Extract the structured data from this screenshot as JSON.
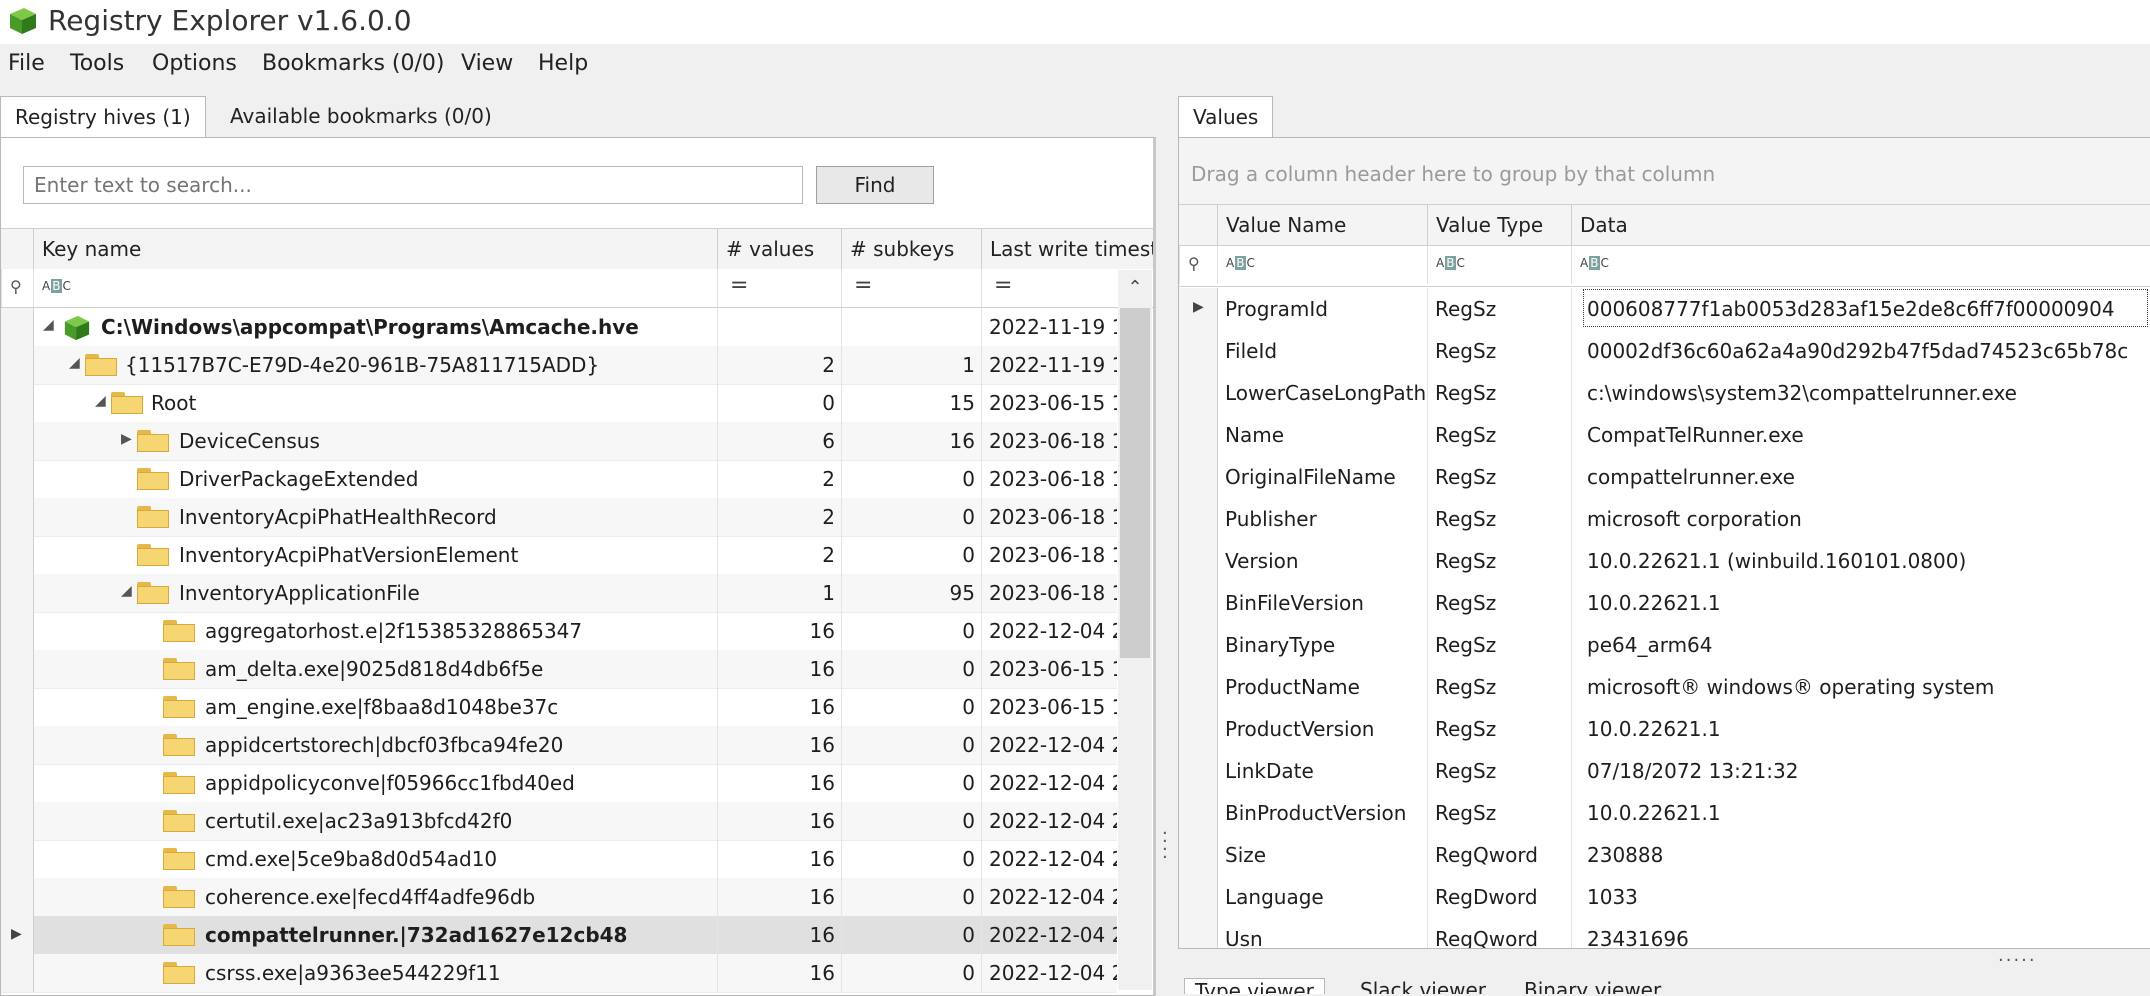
{
  "app": {
    "title": "Registry Explorer v1.6.0.0"
  },
  "menu": [
    "File",
    "Tools",
    "Options",
    "Bookmarks (0/0)",
    "View",
    "Help"
  ],
  "left_tabs": [
    "Registry hives (1)",
    "Available bookmarks (0/0)"
  ],
  "search": {
    "placeholder": "Enter text to search...",
    "find_label": "Find"
  },
  "tree_columns": [
    "Key name",
    "# values",
    "# subkeys",
    "Last write timesta"
  ],
  "tree_rows": [
    {
      "name": "C:\\Windows\\appcompat\\Programs\\Amcache.hve",
      "values": "",
      "subkeys": "",
      "timestamp": "2022-11-19 1"
    },
    {
      "name": "{11517B7C-E79D-4e20-961B-75A811715ADD}",
      "values": "2",
      "subkeys": "1",
      "timestamp": "2022-11-19 1"
    },
    {
      "name": "Root",
      "values": "0",
      "subkeys": "15",
      "timestamp": "2023-06-15 1"
    },
    {
      "name": "DeviceCensus",
      "values": "6",
      "subkeys": "16",
      "timestamp": "2023-06-18 1"
    },
    {
      "name": "DriverPackageExtended",
      "values": "2",
      "subkeys": "0",
      "timestamp": "2023-06-18 1"
    },
    {
      "name": "InventoryAcpiPhatHealthRecord",
      "values": "2",
      "subkeys": "0",
      "timestamp": "2023-06-18 1"
    },
    {
      "name": "InventoryAcpiPhatVersionElement",
      "values": "2",
      "subkeys": "0",
      "timestamp": "2023-06-18 1"
    },
    {
      "name": "InventoryApplicationFile",
      "values": "1",
      "subkeys": "95",
      "timestamp": "2023-06-18 1"
    },
    {
      "name": "aggregatorhost.e|2f15385328865347",
      "values": "16",
      "subkeys": "0",
      "timestamp": "2022-12-04 2"
    },
    {
      "name": "am_delta.exe|9025d818d4db6f5e",
      "values": "16",
      "subkeys": "0",
      "timestamp": "2023-06-15 1"
    },
    {
      "name": "am_engine.exe|f8baa8d1048be37c",
      "values": "16",
      "subkeys": "0",
      "timestamp": "2023-06-15 1"
    },
    {
      "name": "appidcertstorech|dbcf03fbca94fe20",
      "values": "16",
      "subkeys": "0",
      "timestamp": "2022-12-04 2"
    },
    {
      "name": "appidpolicyconve|f05966cc1fbd40ed",
      "values": "16",
      "subkeys": "0",
      "timestamp": "2022-12-04 2"
    },
    {
      "name": "certutil.exe|ac23a913bfcd42f0",
      "values": "16",
      "subkeys": "0",
      "timestamp": "2022-12-04 2"
    },
    {
      "name": "cmd.exe|5ce9ba8d0d54ad10",
      "values": "16",
      "subkeys": "0",
      "timestamp": "2022-12-04 2"
    },
    {
      "name": "coherence.exe|fecd4ff4adfe96db",
      "values": "16",
      "subkeys": "0",
      "timestamp": "2022-12-04 2"
    },
    {
      "name": "compattelrunner.|732ad1627e12cb48",
      "values": "16",
      "subkeys": "0",
      "timestamp": "2022-12-04 2"
    },
    {
      "name": "csrss.exe|a9363ee544229f11",
      "values": "16",
      "subkeys": "0",
      "timestamp": "2022-12-04 2"
    }
  ],
  "values_tab": "Values",
  "group_hint": "Drag a column header here to group by that column",
  "value_columns": [
    "Value Name",
    "Value Type",
    "Data"
  ],
  "value_rows": [
    {
      "name": "ProgramId",
      "type": "RegSz",
      "data": "000608777f1ab0053d283af15e2de8c6ff7f00000904"
    },
    {
      "name": "FileId",
      "type": "RegSz",
      "data": "00002df36c60a62a4a90d292b47f5dad74523c65b78c"
    },
    {
      "name": "LowerCaseLongPath",
      "type": "RegSz",
      "data": "c:\\windows\\system32\\compattelrunner.exe"
    },
    {
      "name": "Name",
      "type": "RegSz",
      "data": "CompatTelRunner.exe"
    },
    {
      "name": "OriginalFileName",
      "type": "RegSz",
      "data": "compattelrunner.exe"
    },
    {
      "name": "Publisher",
      "type": "RegSz",
      "data": "microsoft corporation"
    },
    {
      "name": "Version",
      "type": "RegSz",
      "data": "10.0.22621.1 (winbuild.160101.0800)"
    },
    {
      "name": "BinFileVersion",
      "type": "RegSz",
      "data": "10.0.22621.1"
    },
    {
      "name": "BinaryType",
      "type": "RegSz",
      "data": "pe64_arm64"
    },
    {
      "name": "ProductName",
      "type": "RegSz",
      "data": "microsoft® windows® operating system"
    },
    {
      "name": "ProductVersion",
      "type": "RegSz",
      "data": "10.0.22621.1"
    },
    {
      "name": "LinkDate",
      "type": "RegSz",
      "data": "07/18/2072 13:21:32"
    },
    {
      "name": "BinProductVersion",
      "type": "RegSz",
      "data": "10.0.22621.1"
    },
    {
      "name": "Size",
      "type": "RegQword",
      "data": "230888"
    },
    {
      "name": "Language",
      "type": "RegDword",
      "data": "1033"
    },
    {
      "name": "Usn",
      "type": "RegQword",
      "data": "23431696"
    }
  ],
  "bottom_tabs": [
    "Type viewer",
    "Slack viewer",
    "Binary viewer"
  ]
}
